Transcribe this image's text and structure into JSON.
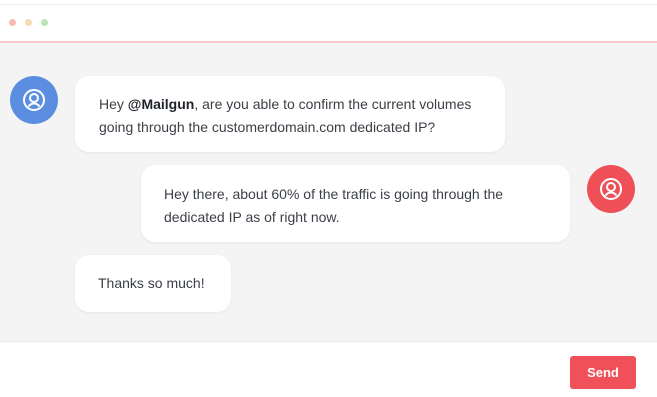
{
  "conversation": {
    "messages": [
      {
        "sender": "user",
        "avatar_color": "#5b8ee0",
        "prefix": "Hey ",
        "mention": "@Mailgun",
        "line1_rest": ", are you able to confirm the current volumes",
        "line2": "going through the customerdomain.com dedicated IP?"
      },
      {
        "sender": "agent",
        "avatar_color": "#ef4f57",
        "line1": "Hey there, about 60% of the traffic is going through the",
        "line2": "dedicated IP as of right now."
      },
      {
        "sender": "user",
        "text": "Thanks so much!"
      }
    ]
  },
  "composer": {
    "send_label": "Send",
    "send_color": "#ef5059"
  },
  "icons": {
    "avatar": "user-circle-icon"
  }
}
